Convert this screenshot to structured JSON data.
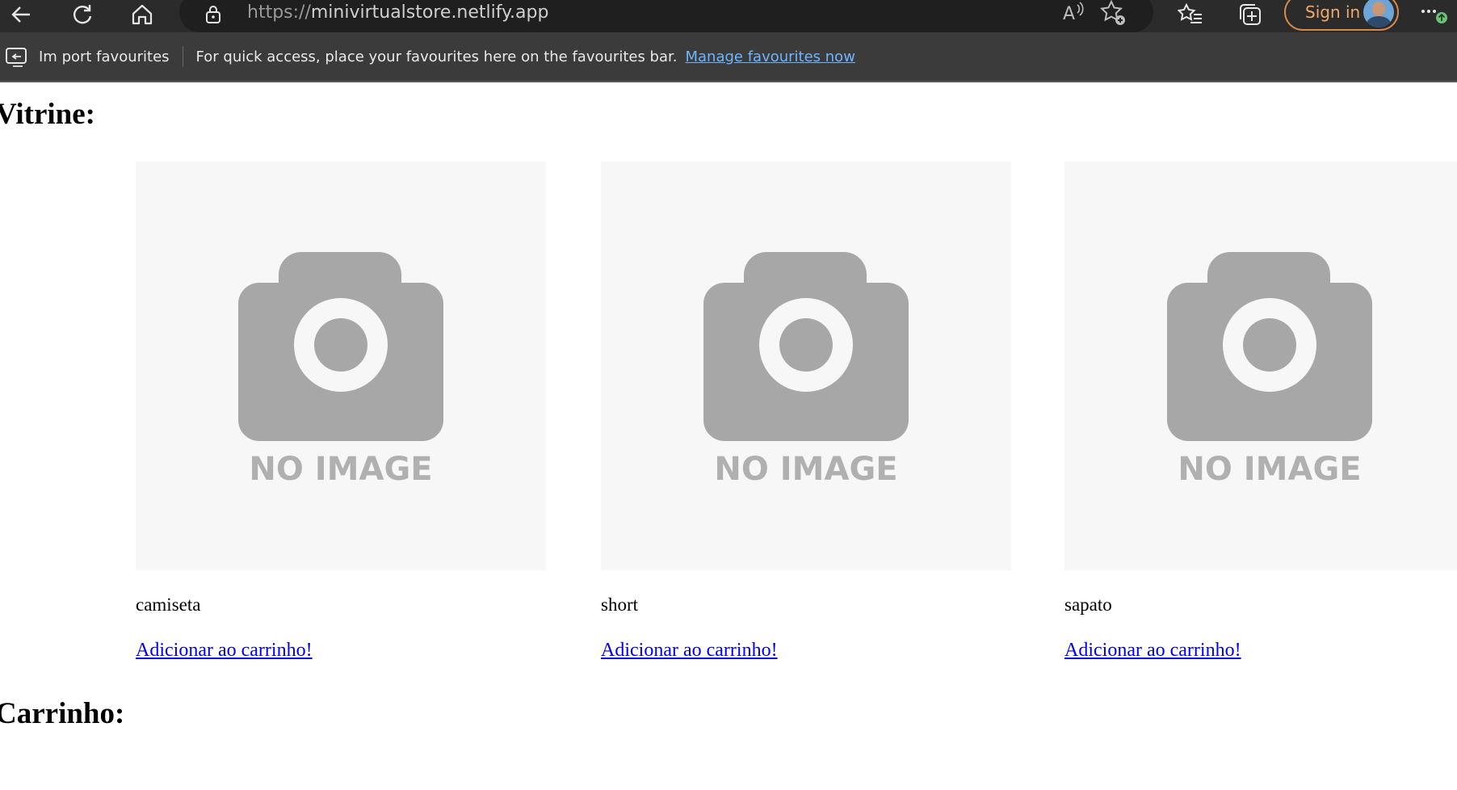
{
  "browser": {
    "url_protocol": "https://",
    "url_host": "minivirtualstore.netlify.app",
    "sign_in_label": "Sign in",
    "favourites_bar": {
      "import_label": "Im port favourites",
      "message": "For quick access, place your favourites here on the favourites bar.",
      "manage_link": "Manage favourites now"
    }
  },
  "page": {
    "vitrine_heading": "Vitrine:",
    "carrinho_heading": "Carrinho:",
    "products": [
      {
        "name": "camiseta",
        "image_text": "NO IMAGE",
        "add_label": "Adicionar ao carrinho!"
      },
      {
        "name": "short",
        "image_text": "NO IMAGE",
        "add_label": "Adicionar ao carrinho!"
      },
      {
        "name": "sapato",
        "image_text": "NO IMAGE",
        "add_label": "Adicionar ao carrinho!"
      }
    ]
  },
  "colors": {
    "link": "#0000ee",
    "placeholder_bg": "#f7f7f7",
    "placeholder_icon": "#a7a7a7",
    "chrome_bg": "#3b3b3b"
  }
}
